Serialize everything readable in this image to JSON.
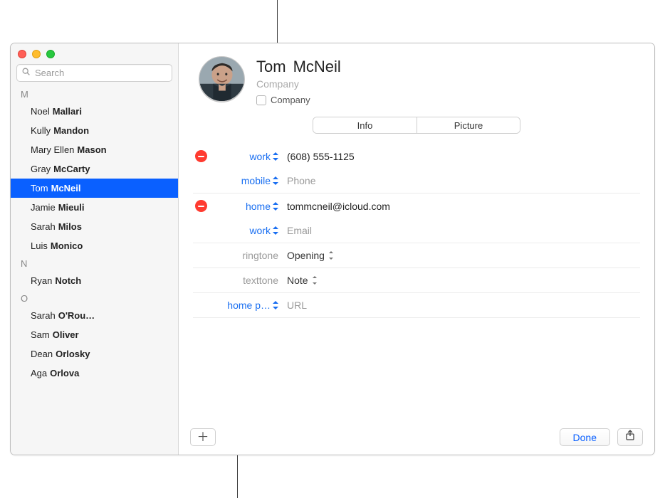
{
  "search": {
    "placeholder": "Search"
  },
  "sections": [
    {
      "letter": "M",
      "items": [
        {
          "first": "Noel",
          "last": "Mallari",
          "selected": false
        },
        {
          "first": "Kully",
          "last": "Mandon",
          "selected": false
        },
        {
          "first": "Mary Ellen",
          "last": "Mason",
          "selected": false
        },
        {
          "first": "Gray",
          "last": "McCarty",
          "selected": false
        },
        {
          "first": "Tom",
          "last": "McNeil",
          "selected": true
        },
        {
          "first": "Jamie",
          "last": "Mieuli",
          "selected": false
        },
        {
          "first": "Sarah",
          "last": "Milos",
          "selected": false
        },
        {
          "first": "Luis",
          "last": "Monico",
          "selected": false
        }
      ]
    },
    {
      "letter": "N",
      "items": [
        {
          "first": "Ryan",
          "last": "Notch",
          "selected": false
        }
      ]
    },
    {
      "letter": "O",
      "items": [
        {
          "first": "Sarah",
          "last": "O'Rou…",
          "selected": false
        },
        {
          "first": "Sam",
          "last": "Oliver",
          "selected": false
        },
        {
          "first": "Dean",
          "last": "Orlosky",
          "selected": false
        },
        {
          "first": "Aga",
          "last": "Orlova",
          "selected": false
        }
      ]
    }
  ],
  "card": {
    "first_name": "Tom",
    "last_name": "McNeil",
    "company_placeholder": "Company",
    "company_checkbox_label": "Company",
    "tabs": {
      "info": "Info",
      "picture": "Picture",
      "active": "info"
    },
    "fields": {
      "phone_work": {
        "label": "work",
        "value": "(608) 555-1125",
        "has_remove": true
      },
      "phone_mobile": {
        "label": "mobile",
        "placeholder": "Phone"
      },
      "email_home": {
        "label": "home",
        "value": "tommcneil@icloud.com",
        "has_remove": true
      },
      "email_work": {
        "label": "work",
        "placeholder": "Email"
      },
      "ringtone": {
        "label": "ringtone",
        "value": "Opening"
      },
      "texttone": {
        "label": "texttone",
        "value": "Note"
      },
      "url": {
        "label": "home p…",
        "placeholder": "URL"
      }
    },
    "done_label": "Done"
  }
}
